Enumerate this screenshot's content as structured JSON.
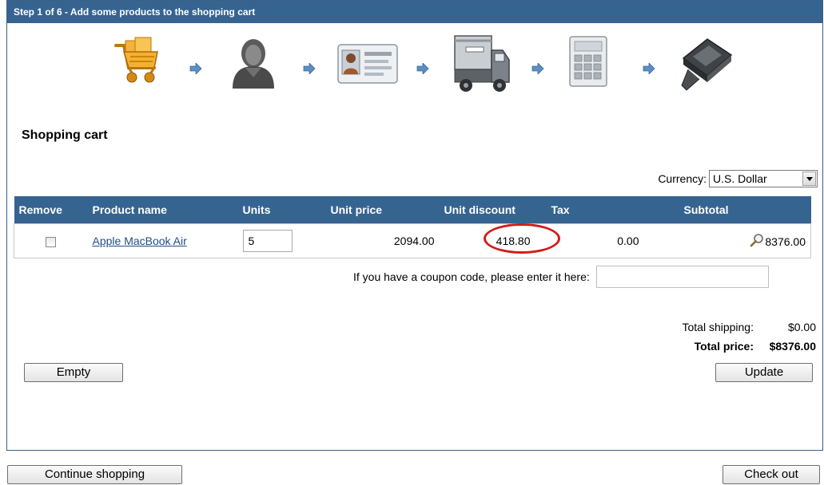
{
  "header": {
    "title": "Step 1 of 6 - Add some products to the shopping cart"
  },
  "steps": [
    {
      "icon": "shopping-cart-icon"
    },
    {
      "icon": "user-icon"
    },
    {
      "icon": "id-card-icon"
    },
    {
      "icon": "delivery-truck-icon"
    },
    {
      "icon": "calculator-icon"
    },
    {
      "icon": "payment-device-icon"
    }
  ],
  "cart": {
    "title": "Shopping cart",
    "currency_label": "Currency:",
    "currency_value": "U.S. Dollar",
    "columns": [
      "Remove",
      "Product name",
      "Units",
      "Unit price",
      "Unit discount",
      "Tax",
      "Subtotal"
    ],
    "items": [
      {
        "product": "Apple MacBook Air",
        "units": "5",
        "unit_price": "2094.00",
        "unit_discount": "418.80",
        "tax": "0.00",
        "subtotal": "8376.00"
      }
    ],
    "coupon_label": "If you have a coupon code, please enter it here:",
    "coupon_value": "",
    "total_shipping_label": "Total shipping:",
    "total_shipping_value": "$0.00",
    "total_price_label": "Total price:",
    "total_price_value": "$8376.00",
    "empty_button": "Empty",
    "update_button": "Update"
  },
  "footer": {
    "continue_button": "Continue shopping",
    "checkout_button": "Check out"
  },
  "colors": {
    "header_bg": "#366491",
    "link": "#1f4d86",
    "highlight_ring": "#d31b1b"
  }
}
